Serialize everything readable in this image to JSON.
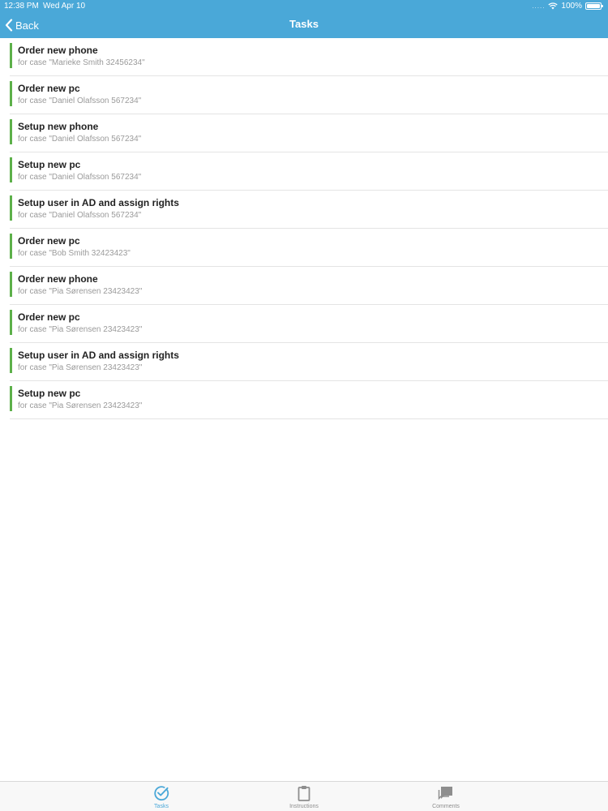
{
  "status_bar": {
    "time": "12:38 PM",
    "date": "Wed Apr 10",
    "signal": ".....",
    "battery": "100%",
    "battery_level": 1.0
  },
  "navbar": {
    "back_label": "Back",
    "title": "Tasks"
  },
  "tasks": [
    {
      "title": "Order new phone",
      "subtitle": "for case \"Marieke Smith 32456234\""
    },
    {
      "title": "Order new pc",
      "subtitle": "for case \"Daniel Olafsson 567234\""
    },
    {
      "title": "Setup new phone",
      "subtitle": "for case \"Daniel Olafsson 567234\""
    },
    {
      "title": "Setup new pc",
      "subtitle": "for case \"Daniel Olafsson 567234\""
    },
    {
      "title": "Setup user in AD and assign rights",
      "subtitle": "for case \"Daniel Olafsson 567234\""
    },
    {
      "title": "Order new pc",
      "subtitle": "for case \"Bob Smith 32423423\""
    },
    {
      "title": "Order new phone",
      "subtitle": "for case \"Pia Sørensen 23423423\""
    },
    {
      "title": "Order new pc",
      "subtitle": "for case \"Pia Sørensen 23423423\""
    },
    {
      "title": "Setup user in AD and assign rights",
      "subtitle": "for case \"Pia Sørensen 23423423\""
    },
    {
      "title": "Setup new pc",
      "subtitle": "for case \"Pia Sørensen 23423423\""
    }
  ],
  "tabbar": {
    "tabs": [
      {
        "label": "Tasks",
        "icon": "check-circle-icon",
        "active": true
      },
      {
        "label": "Instructions",
        "icon": "clipboard-icon",
        "active": false
      },
      {
        "label": "Comments",
        "icon": "comments-icon",
        "active": false
      }
    ]
  },
  "colors": {
    "header": "#4aa8d8",
    "accent": "#4aa8d8",
    "task_indicator": "#5db04a",
    "inactive_tab": "#8e8e8e"
  }
}
